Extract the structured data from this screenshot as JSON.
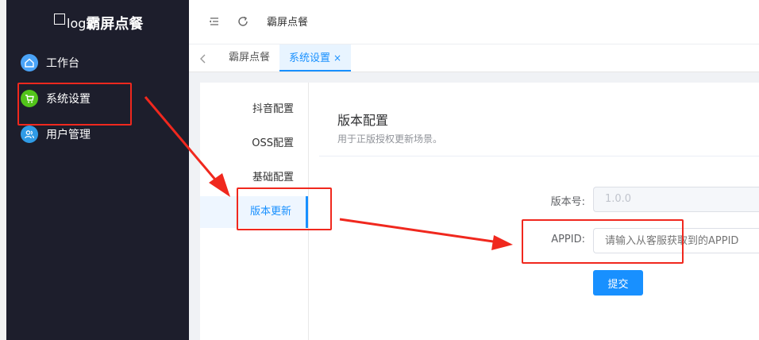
{
  "app": {
    "logo_text": "log",
    "title": "霸屏点餐"
  },
  "sidebar": {
    "items": [
      {
        "label": "工作台",
        "icon": "home-icon",
        "color": "#4aa3f7"
      },
      {
        "label": "系统设置",
        "icon": "cart-icon",
        "color": "#52c41a"
      },
      {
        "label": "用户管理",
        "icon": "users-icon",
        "color": "#2f9be6"
      }
    ]
  },
  "header": {
    "breadcrumb": "霸屏点餐",
    "icons": [
      "menu-fold-icon",
      "refresh-icon"
    ]
  },
  "tabs": [
    {
      "label": "霸屏点餐",
      "active": false
    },
    {
      "label": "系统设置",
      "active": true,
      "close": "×"
    }
  ],
  "subnav": {
    "items": [
      {
        "label": "抖音配置",
        "active": false
      },
      {
        "label": "OSS配置",
        "active": false
      },
      {
        "label": "基础配置",
        "active": false
      },
      {
        "label": "版本更新",
        "active": true
      }
    ]
  },
  "panel": {
    "title": "版本配置",
    "subtitle": "用于正版授权更新场景。"
  },
  "form": {
    "version_label": "版本号:",
    "version_value": "1.0.0",
    "appid_label": "APPID:",
    "appid_placeholder": "请输入从客服获取到的APPID",
    "submit_label": "提交"
  },
  "colors": {
    "sidebar_bg": "#1d1e2c",
    "accent": "#1890ff",
    "annotation": "#f0281e"
  }
}
